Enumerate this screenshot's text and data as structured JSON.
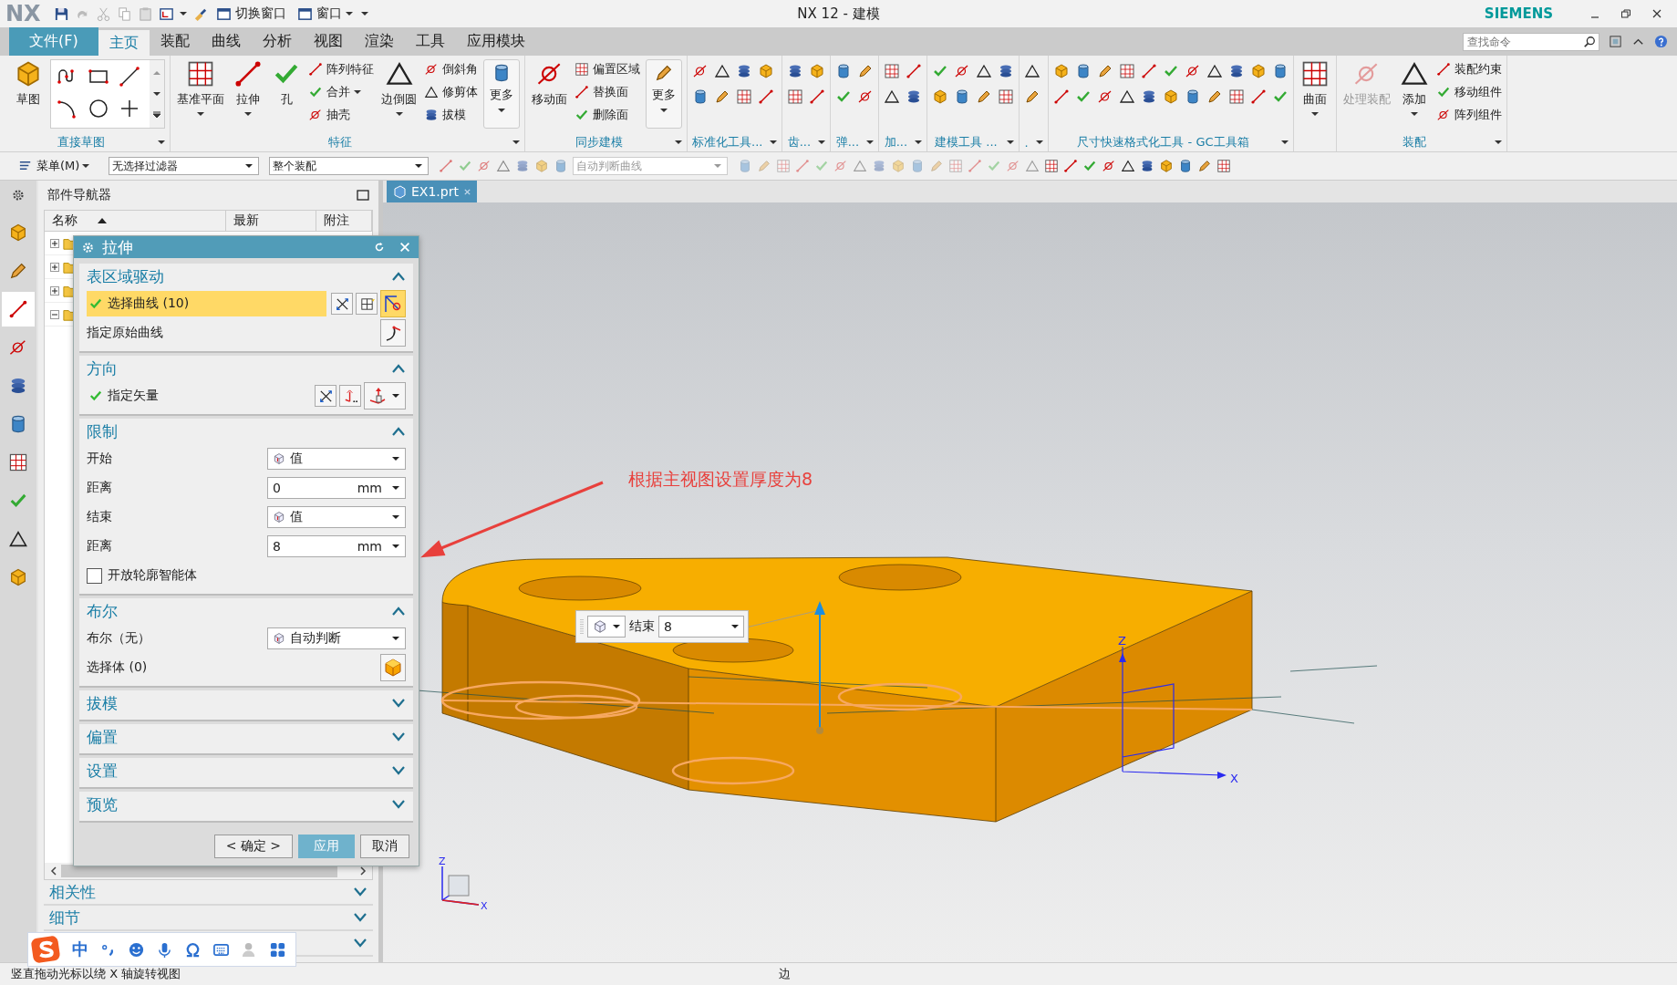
{
  "window": {
    "logo": "NX",
    "title": "NX 12 - 建模",
    "brand": "SIEMENS",
    "quick_access": [
      {
        "label": "切换窗口",
        "dropdown": false
      },
      {
        "label": "窗口",
        "dropdown": true
      }
    ]
  },
  "menu_tabs": [
    {
      "label": "文件(F)",
      "kind": "file",
      "selected": false
    },
    {
      "label": "主页",
      "kind": "tab",
      "selected": true
    },
    {
      "label": "装配",
      "kind": "tab",
      "selected": false
    },
    {
      "label": "曲线",
      "kind": "tab",
      "selected": false
    },
    {
      "label": "分析",
      "kind": "tab",
      "selected": false
    },
    {
      "label": "视图",
      "kind": "tab",
      "selected": false
    },
    {
      "label": "渲染",
      "kind": "tab",
      "selected": false
    },
    {
      "label": "工具",
      "kind": "tab",
      "selected": false
    },
    {
      "label": "应用模块",
      "kind": "tab",
      "selected": false
    }
  ],
  "search": {
    "placeholder": "查找命令"
  },
  "ribbon": [
    {
      "title": "直接草图",
      "columns": [
        {
          "kind": "large",
          "label": "草图",
          "dropdown": false,
          "disabled": false
        },
        {
          "kind": "gallery"
        }
      ]
    },
    {
      "title": "特征",
      "columns": [
        {
          "kind": "large",
          "label": "基准平面",
          "dropdown": true,
          "disabled": false
        },
        {
          "kind": "large",
          "label": "拉伸",
          "dropdown": true,
          "disabled": false
        },
        {
          "kind": "large",
          "label": "孔",
          "dropdown": false,
          "disabled": false
        },
        {
          "kind": "smalls",
          "items": [
            {
              "label": "阵列特征",
              "dropdown": false
            },
            {
              "label": "合并",
              "dropdown": true
            },
            {
              "label": "抽壳",
              "dropdown": false
            }
          ]
        },
        {
          "kind": "large",
          "label": "边倒圆",
          "dropdown": true,
          "disabled": false
        },
        {
          "kind": "smalls",
          "items": [
            {
              "label": "倒斜角",
              "dropdown": false
            },
            {
              "label": "修剪体",
              "dropdown": false
            },
            {
              "label": "拔模",
              "dropdown": false
            }
          ]
        },
        {
          "kind": "more",
          "label": "更多"
        }
      ]
    },
    {
      "title": "同步建模",
      "columns": [
        {
          "kind": "large",
          "label": "移动面",
          "dropdown": false,
          "disabled": false
        },
        {
          "kind": "smalls",
          "items": [
            {
              "label": "偏置区域",
              "dropdown": false
            },
            {
              "label": "替换面",
              "dropdown": false
            },
            {
              "label": "删除面",
              "dropdown": false
            }
          ]
        },
        {
          "kind": "more",
          "label": "更多"
        }
      ]
    },
    {
      "title": "标准化工具...",
      "columns": [
        {
          "kind": "icons"
        },
        {
          "kind": "icons"
        },
        {
          "kind": "icons"
        },
        {
          "kind": "icons"
        }
      ]
    },
    {
      "title": "齿...",
      "columns": [
        {
          "kind": "icons"
        },
        {
          "kind": "icons"
        }
      ]
    },
    {
      "title": "弹...",
      "columns": [
        {
          "kind": "icons"
        },
        {
          "kind": "icons"
        }
      ]
    },
    {
      "title": "加...",
      "columns": [
        {
          "kind": "icons"
        },
        {
          "kind": "icons"
        }
      ]
    },
    {
      "title": "建模工具 ...",
      "columns": [
        {
          "kind": "icons"
        },
        {
          "kind": "icons"
        },
        {
          "kind": "icons"
        },
        {
          "kind": "icons"
        }
      ]
    },
    {
      "title": ".",
      "columns": [
        {
          "kind": "icons"
        }
      ]
    },
    {
      "title": "尺寸快速格式化工具 - GC工具箱",
      "columns": [
        {
          "kind": "icons"
        },
        {
          "kind": "icons"
        },
        {
          "kind": "icons"
        },
        {
          "kind": "icons"
        },
        {
          "kind": "icons"
        },
        {
          "kind": "icons"
        },
        {
          "kind": "icons"
        },
        {
          "kind": "icons"
        },
        {
          "kind": "icons"
        },
        {
          "kind": "icons"
        },
        {
          "kind": "icons"
        }
      ]
    },
    {
      "columns": [
        {
          "kind": "large",
          "label": "曲面",
          "dropdown": true,
          "disabled": false
        }
      ]
    },
    {
      "title": "装配",
      "columns": [
        {
          "kind": "large",
          "label": "处理装配",
          "dropdown": false,
          "disabled": true
        },
        {
          "kind": "large",
          "label": "添加",
          "dropdown": true,
          "disabled": false
        },
        {
          "kind": "smalls",
          "items": [
            {
              "label": "装配约束",
              "dropdown": false
            },
            {
              "label": "移动组件",
              "dropdown": false
            },
            {
              "label": "阵列组件",
              "dropdown": false
            }
          ]
        }
      ]
    }
  ],
  "toolbar": {
    "menu": "菜单(M)",
    "filters": [
      {
        "value": "无选择过滤器",
        "disabled": false
      },
      {
        "value": "整个装配",
        "disabled": false
      },
      {
        "value": "自动判断曲线",
        "disabled": true
      }
    ]
  },
  "side_tabs": [
    {
      "selected": false
    },
    {
      "selected": false
    },
    {
      "selected": true
    },
    {
      "selected": false
    },
    {
      "selected": false
    },
    {
      "selected": false
    },
    {
      "selected": false
    },
    {
      "selected": false
    },
    {
      "selected": false
    },
    {
      "selected": false
    }
  ],
  "navigator": {
    "title": "部件导航器",
    "columns": [
      "名称",
      "最新",
      "附注"
    ],
    "rows": [
      {
        "expanded": false
      },
      {
        "expanded": false
      },
      {
        "expanded": false
      },
      {
        "expanded": true
      }
    ],
    "sections": [
      {
        "title": "相关性",
        "expanded": false
      },
      {
        "title": "细节",
        "expanded": false
      },
      {
        "expanded": false
      }
    ]
  },
  "dialog": {
    "title": "拉伸",
    "sections": [
      {
        "title": "表区域驱动",
        "expanded": true,
        "rows": [
          {
            "kind": "curve_select",
            "label": "选择曲线 (10)",
            "done": true,
            "active": true
          },
          {
            "kind": "origin_curve",
            "label": "指定原始曲线"
          }
        ]
      },
      {
        "title": "方向",
        "expanded": true,
        "rows": [
          {
            "kind": "vector",
            "label": "指定矢量",
            "done": true,
            "active": false
          }
        ]
      },
      {
        "title": "限制",
        "expanded": true,
        "rows": [
          {
            "kind": "dropdown",
            "label": "开始",
            "value": "值"
          },
          {
            "kind": "value",
            "label": "距离",
            "value": "0",
            "unit": "mm"
          },
          {
            "kind": "dropdown",
            "label": "结束",
            "value": "值"
          },
          {
            "kind": "value",
            "label": "距离",
            "value": "8",
            "unit": "mm"
          },
          {
            "kind": "checkbox",
            "label": "开放轮廓智能体",
            "checked": false
          }
        ]
      },
      {
        "title": "布尔",
        "expanded": true,
        "rows": [
          {
            "kind": "dropdown",
            "label": "布尔（无）",
            "value": "自动判断"
          },
          {
            "kind": "body_select",
            "label": "选择体 (0)"
          }
        ]
      },
      {
        "title": "拔模",
        "expanded": false
      },
      {
        "title": "偏置",
        "expanded": false
      },
      {
        "title": "设置",
        "expanded": false
      },
      {
        "title": "预览",
        "expanded": false
      }
    ],
    "buttons": [
      {
        "label": "< 确定 >",
        "selected": false
      },
      {
        "label": "应用",
        "selected": true
      },
      {
        "label": "取消",
        "selected": false
      }
    ]
  },
  "viewport": {
    "tabs": [
      {
        "label": "EX1.prt",
        "selected": true
      }
    ],
    "annotation": "根据主视图设置厚度为8",
    "onscreen_input": {
      "label": "结束",
      "value": "8"
    },
    "datum_labels": [
      "Z",
      "X"
    ],
    "triad_labels": [
      "Z",
      "X"
    ]
  },
  "ime": {
    "mode": "中"
  },
  "status_bar": {
    "message": "竖直拖动光标以绕 X 轴旋转视图",
    "selection": "边"
  }
}
